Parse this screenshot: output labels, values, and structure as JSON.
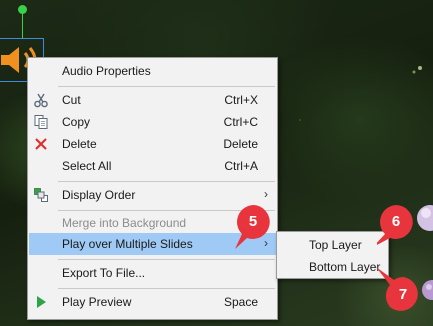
{
  "colors": {
    "menu_bg": "#f2f2f2",
    "menu_highlight": "#9fcaf5",
    "disabled_text": "#8c8c8c",
    "callout_red": "#e8343c",
    "selection_border": "#3b8be0",
    "rotate_handle": "#39d04a",
    "speaker_orange": "#f0901e"
  },
  "context_menu": {
    "items": [
      {
        "label": "Audio Properties",
        "shortcut": "",
        "icon": "none",
        "state": "normal"
      },
      {
        "label": "Cut",
        "shortcut": "Ctrl+X",
        "icon": "scissors-icon",
        "state": "normal"
      },
      {
        "label": "Copy",
        "shortcut": "Ctrl+C",
        "icon": "copy-icon",
        "state": "normal"
      },
      {
        "label": "Delete",
        "shortcut": "Delete",
        "icon": "delete-x-icon",
        "state": "normal"
      },
      {
        "label": "Select All",
        "shortcut": "Ctrl+A",
        "icon": "none",
        "state": "normal"
      },
      {
        "label": "Display Order",
        "shortcut": "",
        "icon": "display-order-icon",
        "state": "normal",
        "submenu": true
      },
      {
        "label": "Merge into Background",
        "shortcut": "",
        "icon": "none",
        "state": "disabled"
      },
      {
        "label": "Play over Multiple Slides",
        "shortcut": "",
        "icon": "none",
        "state": "highlighted",
        "submenu": true
      },
      {
        "label": "Export To File...",
        "shortcut": "",
        "icon": "none",
        "state": "normal"
      },
      {
        "label": "Play Preview",
        "shortcut": "Space",
        "icon": "play-icon",
        "state": "normal"
      }
    ]
  },
  "submenu": {
    "items": [
      {
        "label": "Top Layer"
      },
      {
        "label": "Bottom Layer"
      }
    ]
  },
  "callouts": [
    {
      "number": "5"
    },
    {
      "number": "6"
    },
    {
      "number": "7"
    }
  ]
}
